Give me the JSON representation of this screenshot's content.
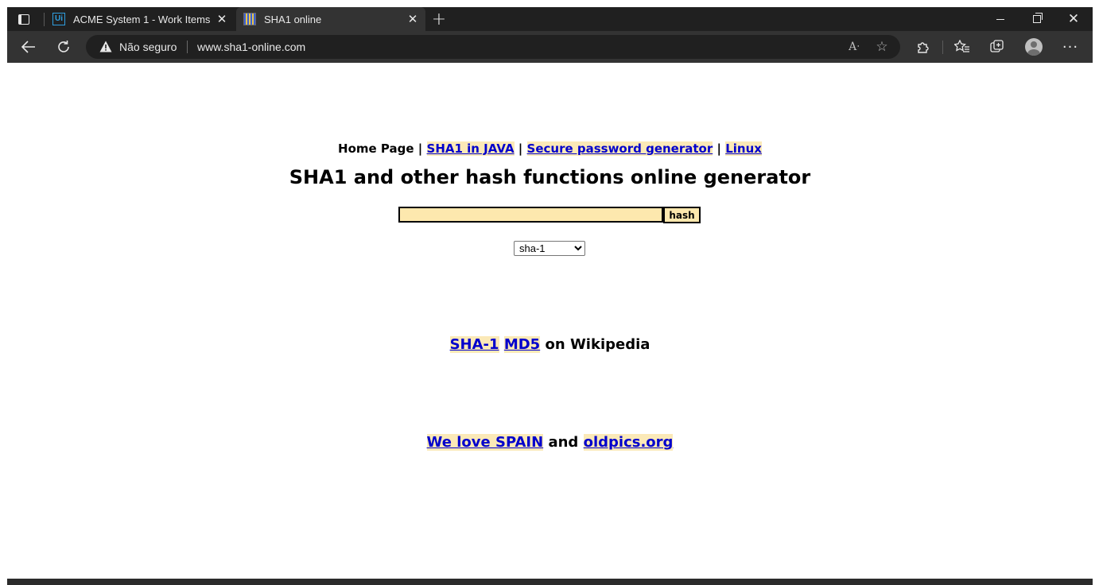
{
  "browser": {
    "tabs": [
      {
        "title": "ACME System 1 - Work Items",
        "favicon": "uipath-icon",
        "active": false
      },
      {
        "title": "SHA1 online",
        "favicon": "sha1-site-icon",
        "active": true
      }
    ],
    "security_label": "Não seguro",
    "url": "www.sha1-online.com",
    "read_aloud_glyph": "A",
    "accent_color": "#333333"
  },
  "page": {
    "nav": {
      "home": "Home Page",
      "separator": "|",
      "links": [
        "SHA1 in JAVA",
        "Secure password generator",
        "Linux"
      ]
    },
    "title": "SHA1 and other hash functions online generator",
    "hash_input": {
      "value": "",
      "placeholder": ""
    },
    "hash_button": "hash",
    "algorithm": {
      "selected": "sha-1"
    },
    "wiki_links": {
      "sha1": "SHA-1",
      "md5": "MD5",
      "suffix": "on Wikipedia"
    },
    "promo": {
      "link1": "We love SPAIN",
      "connector": "and",
      "link2": "oldpics.org"
    },
    "colors": {
      "link": "#0000cc",
      "link_highlight": "#fbe9b7",
      "input_bg": "#fde8ae"
    }
  }
}
